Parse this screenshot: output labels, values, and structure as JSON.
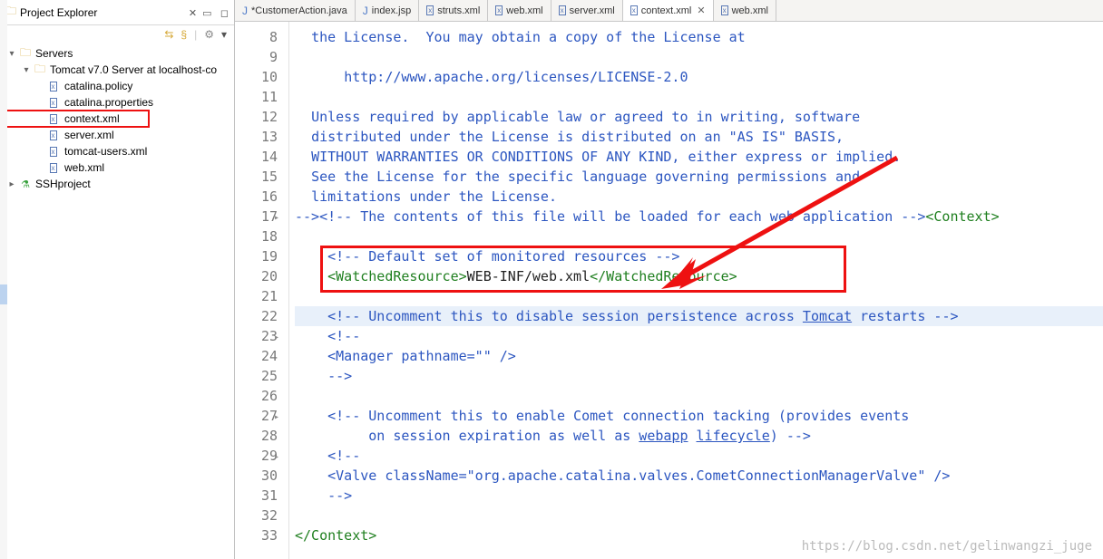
{
  "explorer": {
    "title": "Project Explorer",
    "toolbar": [
      "⇄",
      "↻",
      "▾",
      "⋮",
      "▾"
    ],
    "tree": {
      "servers": "Servers",
      "tomcat": "Tomcat v7.0 Server at localhost-co",
      "files": [
        "catalina.policy",
        "catalina.properties",
        "context.xml",
        "server.xml",
        "tomcat-users.xml",
        "web.xml"
      ],
      "ssh": "SSHproject"
    }
  },
  "tabs": [
    {
      "icon": "j",
      "label": "*CustomerAction.java"
    },
    {
      "icon": "j",
      "label": "index.jsp"
    },
    {
      "icon": "xml",
      "label": "struts.xml"
    },
    {
      "icon": "xml",
      "label": "web.xml"
    },
    {
      "icon": "xml",
      "label": "server.xml"
    },
    {
      "icon": "xml",
      "label": "context.xml",
      "active": true
    },
    {
      "icon": "xml",
      "label": "web.xml"
    }
  ],
  "lines": {
    "start": 8,
    "content": [
      {
        "n": 8,
        "html": "  <span class='cm'>the License.  You may obtain a copy of the License at</span>"
      },
      {
        "n": 9,
        "html": ""
      },
      {
        "n": 10,
        "html": "      <span class='cm'>http://www.apache.org/licenses/LICENSE-2.0</span>"
      },
      {
        "n": 11,
        "html": ""
      },
      {
        "n": 12,
        "html": "  <span class='cm'>Unless required by applicable law or agreed to in writing, software</span>"
      },
      {
        "n": 13,
        "html": "  <span class='cm'>distributed under the License is distributed on an \"AS IS\" BASIS,</span>"
      },
      {
        "n": 14,
        "html": "  <span class='cm'>WITHOUT WARRANTIES OR CONDITIONS OF ANY KIND, either express or implied.</span>"
      },
      {
        "n": 15,
        "html": "  <span class='cm'>See the License for the specific language governing permissions and</span>"
      },
      {
        "n": 16,
        "html": "  <span class='cm'>limitations under the License.</span>"
      },
      {
        "n": 17,
        "html": "<span class='cm'>--&gt;</span><span class='cm'>&lt;!-- The contents of this file will be loaded for each web application --&gt;</span><span class='kw'>&lt;Context&gt;</span>",
        "marker": true
      },
      {
        "n": 18,
        "html": ""
      },
      {
        "n": 19,
        "html": "    <span class='cm'>&lt;!-- Default set of monitored resources --&gt;</span>"
      },
      {
        "n": 20,
        "html": "    <span class='kw'>&lt;WatchedResource&gt;</span><span class='txt'>WEB-INF/web.xml</span><span class='kw'>&lt;/WatchedResource&gt;</span>"
      },
      {
        "n": 21,
        "html": ""
      },
      {
        "n": 22,
        "html": "    <span class='cm'>&lt;!-- Uncomment this to disable session persistence across <u>Tomcat</u> restarts --&gt;</span>",
        "hl": true
      },
      {
        "n": 23,
        "html": "    <span class='cm'>&lt;!--</span>",
        "marker": true
      },
      {
        "n": 24,
        "html": "    <span class='cm'>&lt;Manager pathname=\"\" /&gt;</span>"
      },
      {
        "n": 25,
        "html": "    <span class='cm'>--&gt;</span>"
      },
      {
        "n": 26,
        "html": ""
      },
      {
        "n": 27,
        "html": "    <span class='cm'>&lt;!-- Uncomment this to enable Comet connection tacking (provides events</span>",
        "marker": true
      },
      {
        "n": 28,
        "html": "         <span class='cm'>on session expiration as well as <u>webapp</u> <u>lifecycle</u>) --&gt;</span>"
      },
      {
        "n": 29,
        "html": "    <span class='cm'>&lt;!--</span>",
        "marker": true
      },
      {
        "n": 30,
        "html": "    <span class='cm'>&lt;Valve className=\"org.apache.catalina.valves.CometConnectionManagerValve\" /&gt;</span>"
      },
      {
        "n": 31,
        "html": "    <span class='cm'>--&gt;</span>"
      },
      {
        "n": 32,
        "html": ""
      },
      {
        "n": 33,
        "html": "<span class='kw'>&lt;/Context&gt;</span>"
      }
    ]
  },
  "watermark": "https://blog.csdn.net/gelinwangzi_juge"
}
